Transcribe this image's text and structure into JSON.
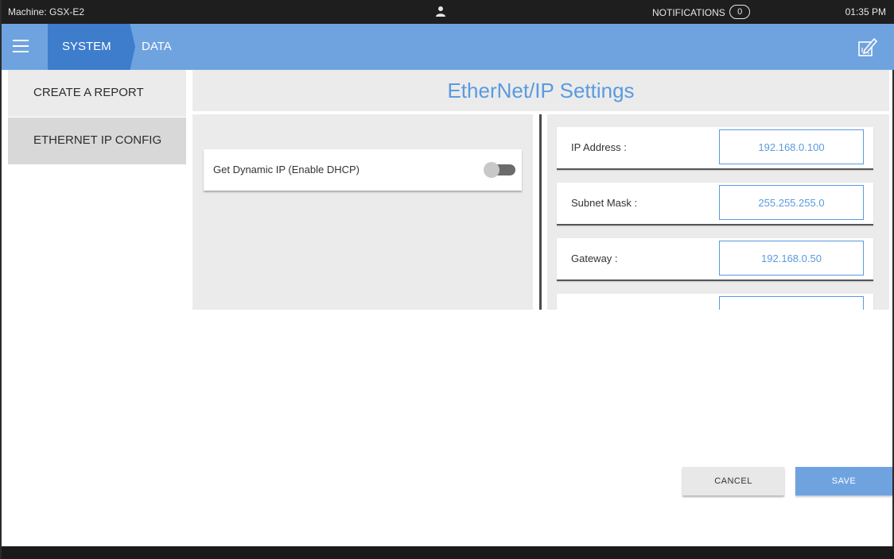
{
  "status_bar": {
    "machine": "Machine: GSX-E2",
    "notifications_label": "NOTIFICATIONS",
    "notifications_count": "0",
    "time": "01:35 PM",
    "user_icon": "user-icon"
  },
  "nav": {
    "menu_icon": "hamburger-menu-icon",
    "tabs": [
      {
        "label": "SYSTEM",
        "active": true
      },
      {
        "label": "DATA",
        "active": false
      }
    ],
    "edit_icon": "edit-icon"
  },
  "sidebar": {
    "items": [
      {
        "label": "CREATE A REPORT",
        "active": false
      },
      {
        "label": "ETHERNET IP CONFIG",
        "active": true
      }
    ]
  },
  "page": {
    "title": "EtherNet/IP Settings"
  },
  "dhcp": {
    "label": "Get Dynamic IP (Enable DHCP)",
    "enabled": false
  },
  "fields": [
    {
      "label": "IP Address :",
      "value": "192.168.0.100"
    },
    {
      "label": "Subnet Mask :",
      "value": "255.255.255.0"
    },
    {
      "label": "Gateway :",
      "value": "192.168.0.50"
    },
    {
      "label": "",
      "value": ""
    }
  ],
  "actions": {
    "cancel_label": "CANCEL",
    "save_label": "SAVE"
  },
  "colors": {
    "accent": "#6fa3e0",
    "accent_dark": "#3e7ccc",
    "title_text": "#5b9ae0",
    "statusbar_bg": "#1e1e1e"
  }
}
